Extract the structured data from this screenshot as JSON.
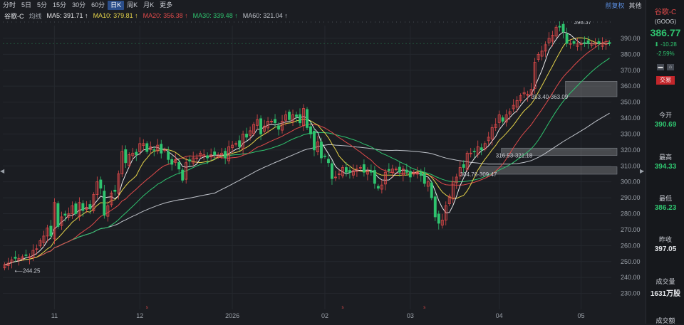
{
  "toolbar": {
    "timeframes": [
      "分时",
      "5日",
      "5分",
      "15分",
      "30分",
      "60分",
      "日K",
      "周K",
      "月K",
      "更多"
    ],
    "active_index": 6,
    "right_link": "前复权",
    "right_other": "其他"
  },
  "ma_bar": {
    "name": "谷歌-C",
    "selector": "均线",
    "items": [
      {
        "label": "MA5: 391.71 ↑",
        "color": "#e8e8ea"
      },
      {
        "label": "MA10: 379.81 ↑",
        "color": "#e6d44a"
      },
      {
        "label": "MA20: 356.38 ↑",
        "color": "#e04a4a"
      },
      {
        "label": "MA30: 339.48 ↑",
        "color": "#2fc46f"
      },
      {
        "label": "MA60: 321.04 ↑",
        "color": "#bfc3ca"
      }
    ]
  },
  "side": {
    "name": "谷歌-C",
    "ticker": "(GOOG)",
    "price": "386.77",
    "change": "⬇ -10.28",
    "change_pct": "-2.59%",
    "trade": "交易",
    "open_label": "今开",
    "open": "390.69",
    "high_label": "最高",
    "high": "394.33",
    "low_label": "最低",
    "low": "386.23",
    "prev_label": "昨收",
    "prev": "397.05",
    "vol_label": "成交量",
    "vol": "1631万股",
    "amt_label": "成交额"
  },
  "chart_data": {
    "type": "candlestick",
    "ylim": [
      220,
      398
    ],
    "y_ticks": [
      230,
      240,
      250,
      260,
      270,
      280,
      290,
      300,
      310,
      320,
      330,
      340,
      350,
      360,
      370,
      380,
      390
    ],
    "x_ticks": [
      "11",
      "12",
      "2026",
      "02",
      "03",
      "04",
      "05"
    ],
    "x_tick_positions": [
      14,
      38,
      64,
      90,
      114,
      139,
      162
    ],
    "n_candles": 171,
    "closes": [
      248,
      249,
      251,
      252,
      252,
      253,
      254,
      253,
      257,
      258,
      263,
      266,
      271,
      266,
      287,
      272,
      278,
      279,
      280,
      285,
      280,
      287,
      282,
      284,
      283,
      292,
      300,
      296,
      279,
      285,
      293,
      294,
      305,
      319,
      312,
      317,
      318,
      317,
      324,
      324,
      319,
      322,
      320,
      323,
      318,
      320,
      314,
      311,
      314,
      308,
      301,
      312,
      313,
      315,
      315,
      318,
      317,
      315,
      317,
      317,
      317,
      318,
      315,
      322,
      323,
      324,
      322,
      330,
      328,
      332,
      336,
      339,
      330,
      335,
      338,
      338,
      337,
      333,
      338,
      342,
      339,
      342,
      341,
      337,
      346,
      334,
      330,
      320,
      325,
      315,
      316,
      312,
      302,
      303,
      305,
      309,
      306,
      306,
      307,
      308,
      309,
      306,
      307,
      306,
      299,
      296,
      298,
      306,
      307,
      308,
      308,
      306,
      308,
      306,
      303,
      306,
      306,
      304,
      299,
      300,
      290,
      278,
      274,
      276,
      285,
      291,
      300,
      303,
      309,
      309,
      318,
      318,
      319,
      322,
      320,
      324,
      328,
      334,
      336,
      342,
      338,
      342,
      344,
      348,
      351,
      354,
      356,
      355,
      358,
      375,
      380,
      382,
      386,
      390,
      392,
      397,
      397,
      394,
      386.77
    ],
    "last_close": 386.77,
    "prev_close": 397.05,
    "annotations": [
      {
        "text": "244.25"
      },
      {
        "text": "398.37"
      },
      {
        "text": "353.40-363.09"
      },
      {
        "text": "316.53-321.18"
      },
      {
        "text": "304.76-309.47"
      }
    ],
    "zones": [
      {
        "low": 353.4,
        "high": 363.09,
        "from_index": 158
      },
      {
        "low": 316.53,
        "high": 321.18,
        "from_index": 140
      },
      {
        "low": 304.76,
        "high": 309.47,
        "from_index": 134
      }
    ],
    "ma_colors": {
      "ma5": "#e8e8ea",
      "ma10": "#e6d44a",
      "ma20": "#e04a4a",
      "ma30": "#2fc46f",
      "ma60": "#bfc3ca"
    },
    "up_color": "#e04a4a",
    "down_color": "#2fc46f"
  }
}
